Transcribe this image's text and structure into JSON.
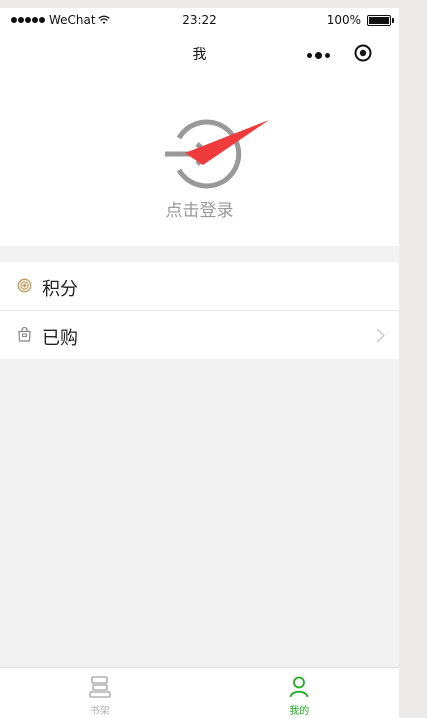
{
  "status_bar": {
    "carrier": "WeChat",
    "time": "23:22",
    "battery": "100%"
  },
  "nav": {
    "title": "我"
  },
  "login": {
    "label": "点击登录"
  },
  "menu": {
    "items": [
      {
        "label": "积分",
        "icon": "points-coin-icon"
      },
      {
        "label": "已购",
        "icon": "purchase-bag-icon"
      }
    ]
  },
  "tabbar": {
    "tabs": [
      {
        "label": "书架",
        "icon": "bookshelf-icon",
        "active": false
      },
      {
        "label": "我的",
        "icon": "person-icon",
        "active": true
      }
    ],
    "active_color": "#1aad19",
    "inactive_color": "#b2b2b2"
  },
  "colors": {
    "arrow": "#ef3b3b",
    "login_icon": "#999999",
    "page_bg": "#f2f2f2",
    "points_icon": "#c49a5a"
  }
}
